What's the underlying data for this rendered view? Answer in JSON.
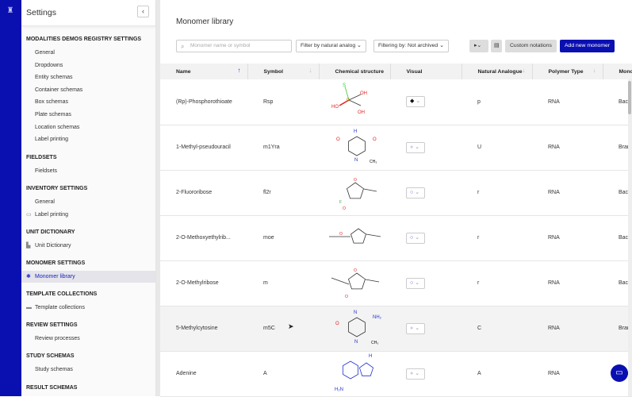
{
  "sidebar": {
    "title": "Settings",
    "sections": [
      {
        "title": "MODALITIES DEMOS REGISTRY SETTINGS",
        "items": [
          "General",
          "Dropdowns",
          "Entity schemas",
          "Container schemas",
          "Box schemas",
          "Plate schemas",
          "Location schemas",
          "Label printing"
        ]
      },
      {
        "title": "FIELDSETS",
        "items": [
          "Fieldsets"
        ]
      },
      {
        "title": "INVENTORY SETTINGS",
        "items": [
          "General",
          "Label printing"
        ]
      },
      {
        "title": "UNIT DICTIONARY",
        "items": [
          "Unit Dictionary"
        ]
      },
      {
        "title": "MONOMER SETTINGS",
        "items": [
          "Monomer library"
        ]
      },
      {
        "title": "TEMPLATE COLLECTIONS",
        "items": [
          "Template collections"
        ]
      },
      {
        "title": "REVIEW SETTINGS",
        "items": [
          "Review processes"
        ]
      },
      {
        "title": "STUDY SCHEMAS",
        "items": [
          "Study schemas"
        ]
      },
      {
        "title": "RESULT SCHEMAS",
        "items": []
      }
    ]
  },
  "main": {
    "title": "Monomer library",
    "search_placeholder": "Monomer name or symbol",
    "filter_analog": "Filter by natural analog",
    "filter_archived": "Filtering by: Not archived",
    "custom_notations": "Custom notations",
    "add_new": "Add new monomer",
    "columns": [
      "Name",
      "Symbol",
      "Chemical structure",
      "Visual",
      "Natural Analogue",
      "Polymer Type",
      "Monor"
    ],
    "rows": [
      {
        "name": "(Rp)-Phosphorothioate",
        "symbol": "Rsp",
        "visual": "◆",
        "natural": "p",
        "polymer": "RNA",
        "type": "Backb"
      },
      {
        "name": "1-Methyl-pseudouracil",
        "symbol": "m1Yra",
        "visual": "●",
        "natural": "U",
        "polymer": "RNA",
        "type": "Branc"
      },
      {
        "name": "2-Fluororibose",
        "symbol": "fl2r",
        "visual": "○",
        "natural": "r",
        "polymer": "RNA",
        "type": "Backb"
      },
      {
        "name": "2-O-Methoxyethylrib...",
        "symbol": "moe",
        "visual": "○",
        "natural": "r",
        "polymer": "RNA",
        "type": "Backb"
      },
      {
        "name": "2-O-Methylribose",
        "symbol": "m",
        "visual": "○",
        "natural": "r",
        "polymer": "RNA",
        "type": "Backb"
      },
      {
        "name": "5-Methylcytosine",
        "symbol": "m5C",
        "visual": "●",
        "natural": "C",
        "polymer": "RNA",
        "type": "Branc"
      },
      {
        "name": "Adenine",
        "symbol": "A",
        "visual": "●",
        "natural": "A",
        "polymer": "RNA",
        "type": "Branc"
      }
    ]
  }
}
